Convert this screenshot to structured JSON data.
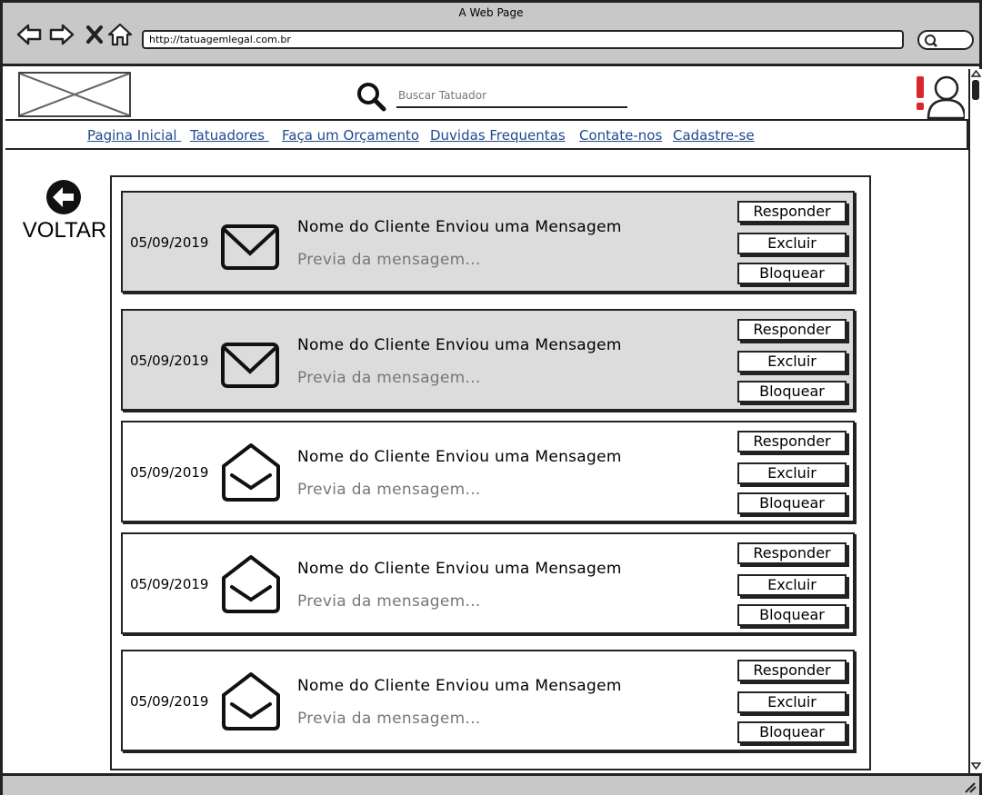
{
  "window": {
    "title": "A Web Page",
    "url": "http://tatuagemlegal.com.br"
  },
  "header": {
    "logo": "",
    "search_placeholder": "Buscar Tatuador"
  },
  "nav": [
    "Pagina Inicial ",
    "Tatuadores ",
    "Faça um Orçamento",
    "Duvidas Frequentas",
    "Contate-nos",
    "Cadastre-se"
  ],
  "back": {
    "label": "VOLTAR",
    "icon": "arrow-left-circle-icon"
  },
  "messages": [
    {
      "date": "05/09/2019",
      "title": "Nome do Cliente Enviou uma Mensagem",
      "preview": "Previa da mensagem...",
      "status": "unread",
      "icon": "envelope-closed-icon"
    },
    {
      "date": "05/09/2019",
      "title": "Nome do Cliente Enviou uma Mensagem",
      "preview": "Previa da mensagem...",
      "status": "unread",
      "icon": "envelope-closed-icon"
    },
    {
      "date": "05/09/2019",
      "title": "Nome do Cliente Enviou uma Mensagem",
      "preview": "Previa da mensagem...",
      "status": "read",
      "icon": "envelope-open-icon"
    },
    {
      "date": "05/09/2019",
      "title": "Nome do Cliente Enviou uma Mensagem",
      "preview": "Previa da mensagem...",
      "status": "read",
      "icon": "envelope-open-icon"
    },
    {
      "date": "05/09/2019",
      "title": "Nome do Cliente Enviou uma Mensagem",
      "preview": "Previa da mensagem...",
      "status": "read",
      "icon": "envelope-open-icon"
    }
  ],
  "actions": {
    "reply": "Responder",
    "delete": "Excluir",
    "block": "Bloquear"
  },
  "colors": {
    "chrome": "#c8c8c8",
    "unread_bg": "#dcdcdc",
    "link": "#1f4a8c",
    "alert": "#d9262b"
  }
}
